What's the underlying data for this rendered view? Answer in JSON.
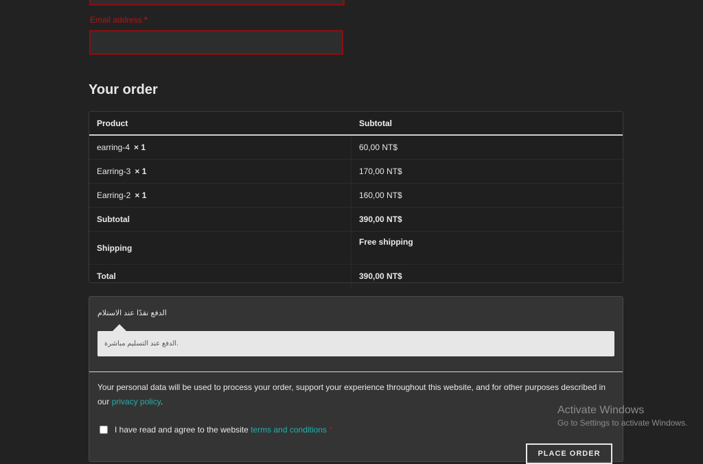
{
  "form": {
    "email_label": "Email address",
    "email_required": "*",
    "email_value": ""
  },
  "order": {
    "heading": "Your order",
    "headers": {
      "product": "Product",
      "subtotal": "Subtotal"
    },
    "items": [
      {
        "name": "earring-4",
        "qty": "× 1",
        "price": "60,00 NT$"
      },
      {
        "name": "Earring-3",
        "qty": "× 1",
        "price": "170,00 NT$"
      },
      {
        "name": "Earring-2",
        "qty": "× 1",
        "price": "160,00 NT$"
      }
    ],
    "subtotal_label": "Subtotal",
    "subtotal_value": "390,00 NT$",
    "shipping_label": "Shipping",
    "shipping_value": "Free shipping",
    "total_label": "Total",
    "total_value": "390,00 NT$"
  },
  "payment": {
    "method_label": "الدفع نقدًا عند الاستلام",
    "method_description": "الدفع عند التسليم مباشرة."
  },
  "privacy": {
    "text_before": "Your personal data will be used to process your order, support your experience throughout this website, and for other purposes described in our ",
    "link_text": "privacy policy",
    "text_after": "."
  },
  "terms": {
    "text": "I have read and agree to the website ",
    "link_text": "terms and conditions",
    "required": "*",
    "checked": false
  },
  "place_order_label": "PLACE ORDER",
  "watermark": {
    "title": "Activate Windows",
    "subtitle": "Go to Settings to activate Windows."
  }
}
